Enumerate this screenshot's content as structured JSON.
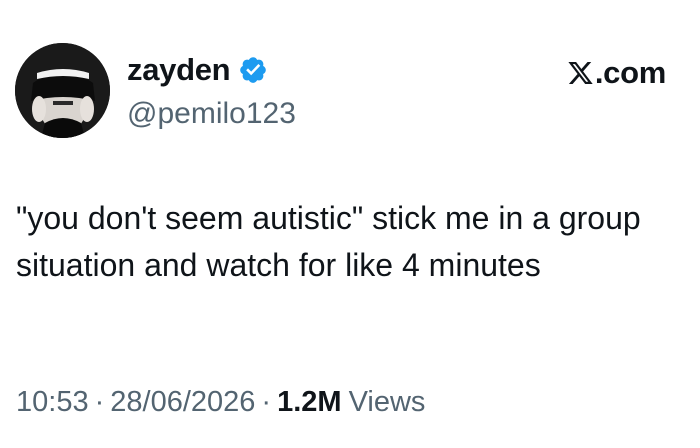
{
  "author": {
    "display_name": "zayden",
    "handle": "@pemilo123",
    "verified": true,
    "avatar_icon": "avatar-photo"
  },
  "site": {
    "label": ".com",
    "logo_icon": "x-logo-icon"
  },
  "tweet": {
    "text": "\"you don't seem autistic\" stick me in a group situation and watch for like 4 minutes"
  },
  "meta": {
    "time": "10:53",
    "separator": "·",
    "date": "28/06/2026",
    "views_count": "1.2M",
    "views_label": "Views"
  },
  "colors": {
    "text_primary": "#0f1419",
    "text_secondary": "#536471",
    "verified_blue": "#1d9bf0",
    "background": "#ffffff"
  }
}
